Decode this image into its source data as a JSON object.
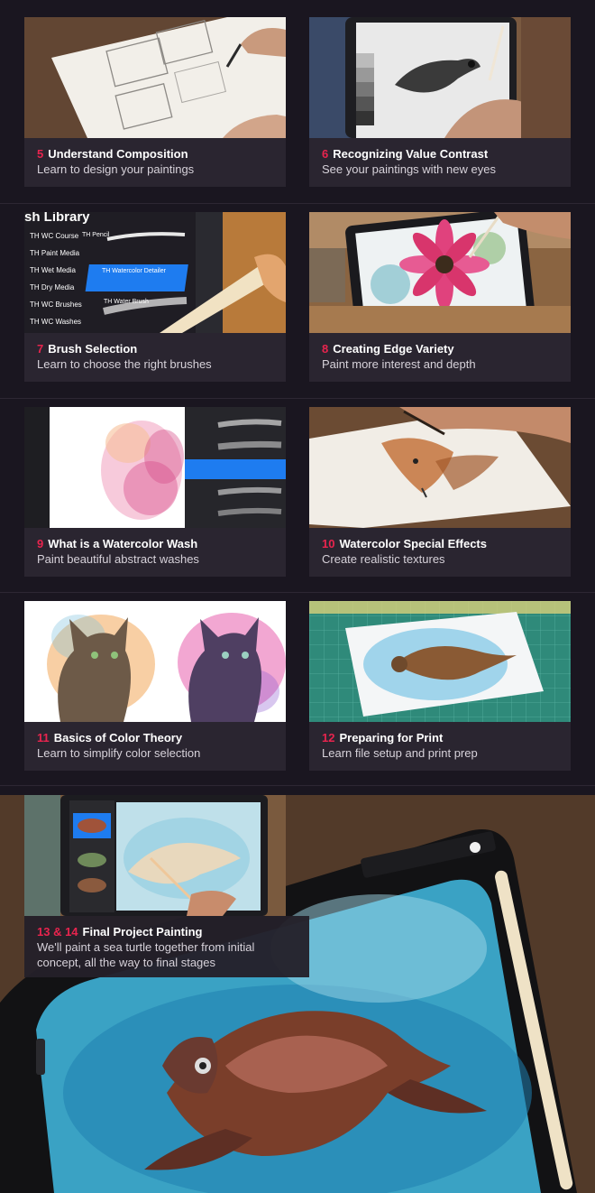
{
  "lessons": [
    {
      "num": "5",
      "title": "Understand Composition",
      "subtitle": "Learn to design your paintings"
    },
    {
      "num": "6",
      "title": "Recognizing Value Contrast",
      "subtitle": "See your paintings with new eyes"
    },
    {
      "num": "7",
      "title": "Brush Selection",
      "subtitle": "Learn to choose the right brushes"
    },
    {
      "num": "8",
      "title": "Creating Edge Variety",
      "subtitle": "Paint more interest and depth"
    },
    {
      "num": "9",
      "title": "What is a Watercolor Wash",
      "subtitle": "Paint beautiful abstract washes"
    },
    {
      "num": "10",
      "title": "Watercolor Special Effects",
      "subtitle": "Create realistic textures"
    },
    {
      "num": "11",
      "title": "Basics of Color Theory",
      "subtitle": "Learn to simplify color selection"
    },
    {
      "num": "12",
      "title": "Preparing for Print",
      "subtitle": "Learn file setup and print prep"
    }
  ],
  "final": {
    "num": "13 & 14",
    "title": "Final Project Painting",
    "subtitle": "We'll paint a sea turtle together from initial concept, all the way to final stages"
  },
  "brush_library": {
    "header": "sh Library",
    "categories": [
      "TH WC Course",
      "TH Paint Media",
      "TH Wet Media",
      "TH Dry Media",
      "TH WC Brushes",
      "TH WC Washes"
    ],
    "brushes": [
      "TH Pencil",
      "TH Watercolor Detailer",
      "TH Water Brush"
    ]
  },
  "colors": {
    "accent": "#e8244e",
    "caption_bg": "#2a2530",
    "page_bg": "#17131c",
    "title_text": "#ffffff",
    "subtitle_text": "#d7d2da"
  }
}
